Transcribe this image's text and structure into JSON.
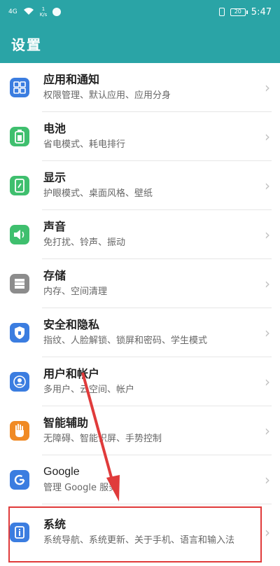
{
  "status_bar": {
    "signal": "4G",
    "speed_top": "1",
    "speed_unit": "K/s",
    "battery": "20",
    "time": "5:47"
  },
  "app_bar": {
    "title": "设置"
  },
  "colors": {
    "header": "#2aa4a6",
    "highlight": "#e03b3b"
  },
  "items": [
    {
      "icon": "apps-grid-icon",
      "title": "应用和通知",
      "subtitle": "权限管理、默认应用、应用分身"
    },
    {
      "icon": "battery-icon",
      "title": "电池",
      "subtitle": "省电模式、耗电排行"
    },
    {
      "icon": "display-icon",
      "title": "显示",
      "subtitle": "护眼模式、桌面风格、壁纸"
    },
    {
      "icon": "sound-icon",
      "title": "声音",
      "subtitle": "免打扰、铃声、振动"
    },
    {
      "icon": "storage-icon",
      "title": "存储",
      "subtitle": "内存、空间清理"
    },
    {
      "icon": "security-shield-icon",
      "title": "安全和隐私",
      "subtitle": "指纹、人脸解锁、锁屏和密码、学生模式"
    },
    {
      "icon": "user-account-icon",
      "title": "用户和帐户",
      "subtitle": "多用户、云空间、帐户"
    },
    {
      "icon": "hand-assist-icon",
      "title": "智能辅助",
      "subtitle": "无障碍、智能识屏、手势控制"
    },
    {
      "icon": "google-icon",
      "title": "Google",
      "subtitle": "管理 Google 服务"
    },
    {
      "icon": "system-info-icon",
      "title": "系统",
      "subtitle": "系统导航、系统更新、关于手机、语言和输入法"
    }
  ]
}
